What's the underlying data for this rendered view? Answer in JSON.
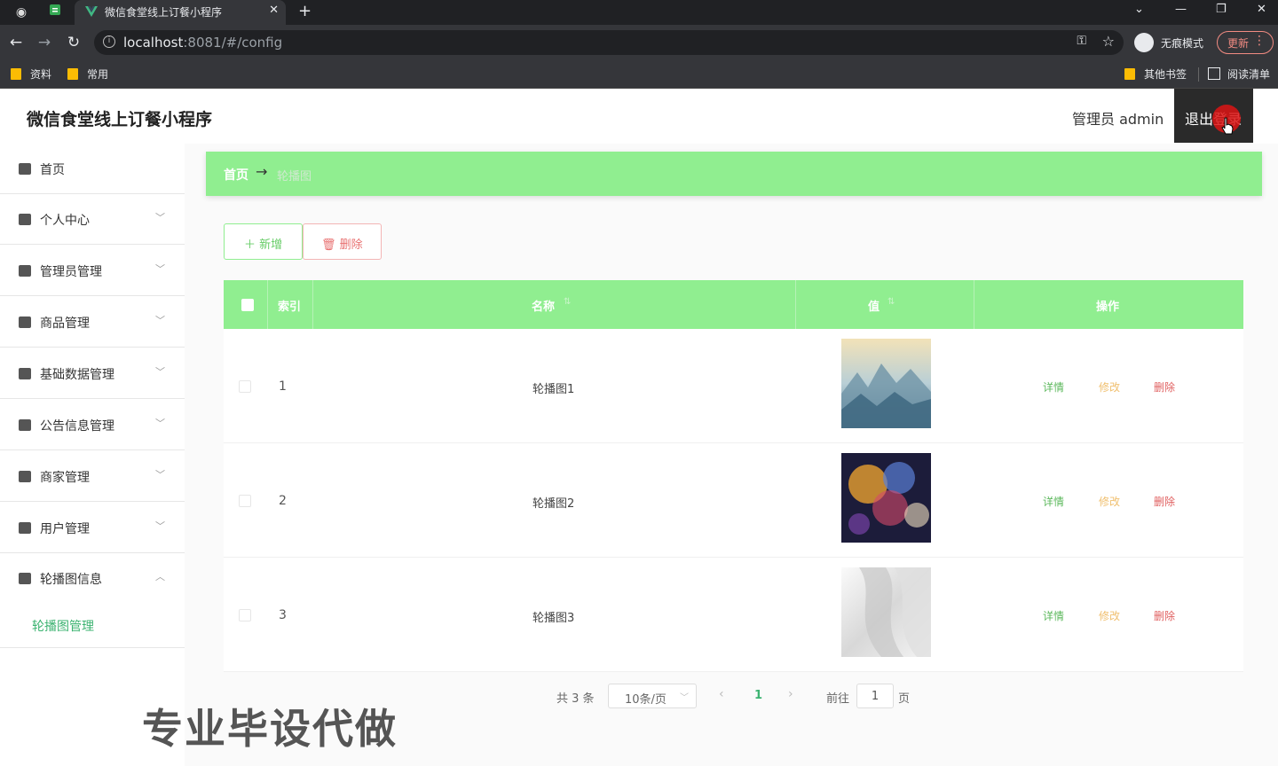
{
  "browser": {
    "tab_title": "微信食堂线上订餐小程序",
    "url_host": "localhost",
    "url_rest": ":8081/#/config",
    "incognito_label": "无痕模式",
    "update_label": "更新",
    "bookmarks": [
      "资料",
      "常用"
    ],
    "bookmarks_right": [
      "其他书签",
      "阅读清单"
    ]
  },
  "header": {
    "title": "微信食堂线上订餐小程序",
    "admin_label": "管理员 admin",
    "logout_label": "退出登录"
  },
  "sidebar": {
    "items": [
      {
        "label": "首页",
        "icon": "home-icon"
      },
      {
        "label": "个人中心",
        "icon": "user-icon"
      },
      {
        "label": "管理员管理",
        "icon": "admin-icon"
      },
      {
        "label": "商品管理",
        "icon": "goods-icon"
      },
      {
        "label": "基础数据管理",
        "icon": "data-icon"
      },
      {
        "label": "公告信息管理",
        "icon": "grid-icon"
      },
      {
        "label": "商家管理",
        "icon": "clipboard-icon"
      },
      {
        "label": "用户管理",
        "icon": "users-icon"
      },
      {
        "label": "轮播图信息",
        "icon": "carousel-icon"
      }
    ],
    "submenu_label": "轮播图管理"
  },
  "breadcrumb": {
    "home": "首页",
    "arrow": "→",
    "current": "轮播图"
  },
  "actions": {
    "add_label": "新增",
    "delete_label": "删除"
  },
  "table": {
    "columns": [
      "索引",
      "名称",
      "值",
      "操作"
    ],
    "rows": [
      {
        "index": "1",
        "name": "轮播图1"
      },
      {
        "index": "2",
        "name": "轮播图2"
      },
      {
        "index": "3",
        "name": "轮播图3"
      }
    ],
    "ops": {
      "detail": "详情",
      "edit": "修改",
      "delete": "删除"
    }
  },
  "pager": {
    "total": "共 3 条",
    "page_size": "10条/页",
    "current_page": "1",
    "goto_label": "前往",
    "goto_value": "1",
    "page_unit": "页"
  },
  "watermark": "专业毕设代做",
  "colors": {
    "accent": "#90ee90",
    "link_green": "#3cb371",
    "danger": "#e06060",
    "warning": "#f0c070"
  }
}
